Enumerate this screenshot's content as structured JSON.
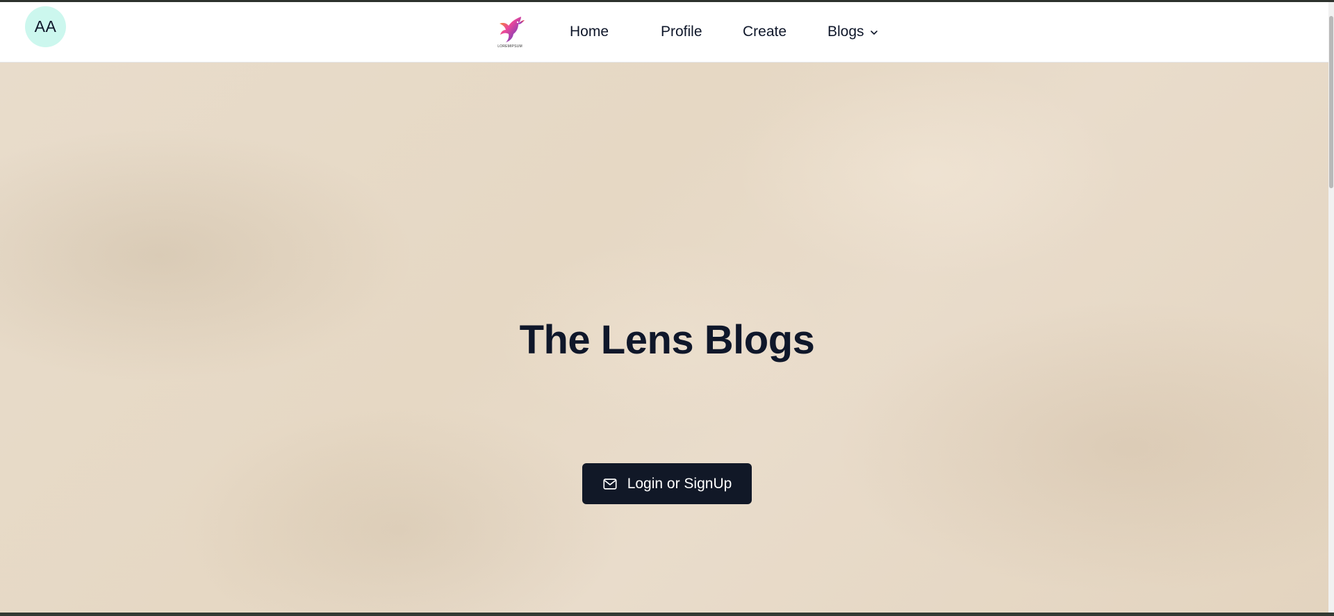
{
  "navbar": {
    "avatar_initials": "AA",
    "logo_text": "LOREMIPSUM",
    "links": [
      {
        "label": "Home"
      },
      {
        "label": "Profile"
      },
      {
        "label": "Create"
      },
      {
        "label": "Blogs"
      }
    ]
  },
  "hero": {
    "title": "The Lens Blogs",
    "login_button_label": "Login or SignUp"
  },
  "colors": {
    "avatar_bg": "#ccf7ee",
    "text_dark": "#0f172a",
    "button_bg": "#111827",
    "hero_bg": "#e6d8c4"
  },
  "icons": [
    "bird-logo-icon",
    "chevron-down-icon",
    "mail-icon"
  ]
}
